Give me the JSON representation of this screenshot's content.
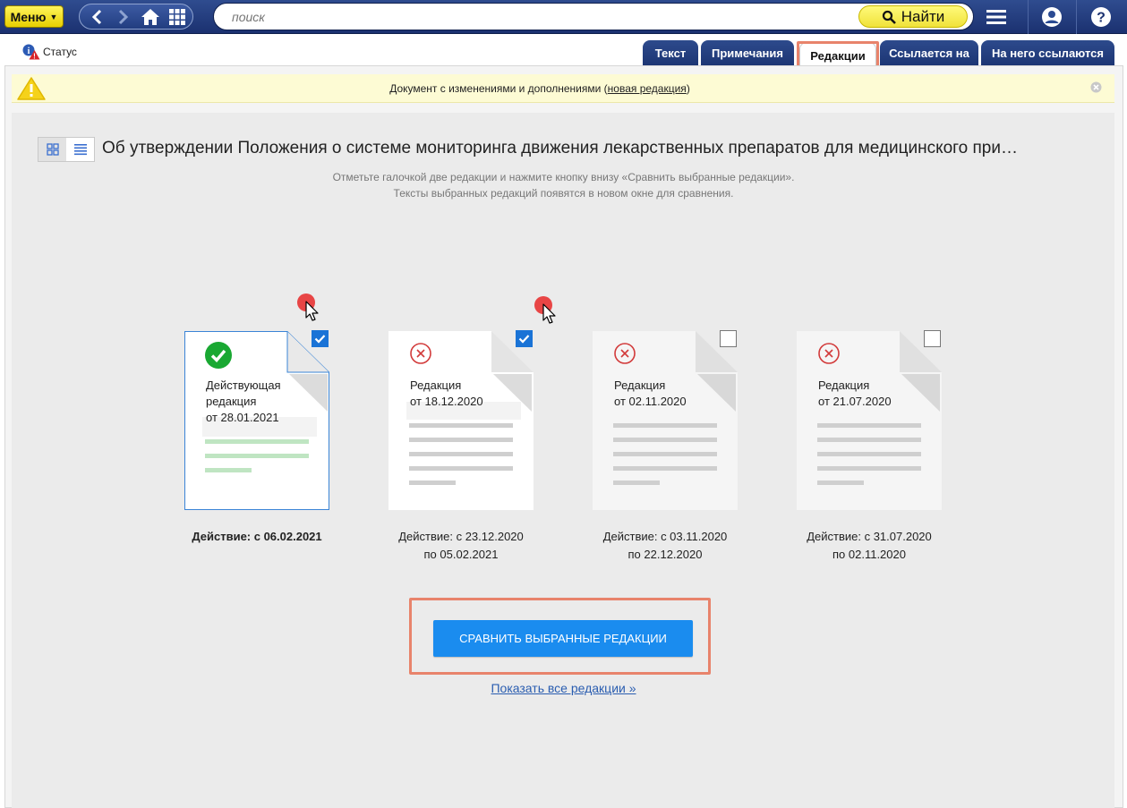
{
  "toolbar": {
    "menu_label": "Меню",
    "search_placeholder": "поиск",
    "find_label": "Найти"
  },
  "status": {
    "label": "Статус"
  },
  "tabs": [
    {
      "label": "Текст",
      "active": false
    },
    {
      "label": "Примечания",
      "active": false
    },
    {
      "label": "Редакции",
      "active": true
    },
    {
      "label": "Ссылается на",
      "active": false
    },
    {
      "label": "На него ссылаются",
      "active": false
    }
  ],
  "notice": {
    "text": "Документ с изменениями и дополнениями (",
    "link": "новая редакция",
    "text_end": ")"
  },
  "document": {
    "title": "Об утверждении Положения о системе мониторинга движения лекарственных препаратов для медицинского при…",
    "hint_line1": "Отметьте галочкой две редакции и нажмите кнопку внизу «Сравнить выбранные редакции».",
    "hint_line2": "Тексты выбранных редакций появятся в новом окне для сравнения."
  },
  "revisions": [
    {
      "line1": "Действующая",
      "line2": "редакция",
      "line3": "от 28.01.2021",
      "action1": "Действие: с 06.02.2021",
      "action2": "",
      "checked": true,
      "current": true
    },
    {
      "line1": "Редакция",
      "line2": "от 18.12.2020",
      "line3": "",
      "action1": "Действие: с 23.12.2020",
      "action2": "по 05.02.2021",
      "checked": true,
      "current": false
    },
    {
      "line1": "Редакция",
      "line2": "от 02.11.2020",
      "line3": "",
      "action1": "Действие: с 03.11.2020",
      "action2": "по 22.12.2020",
      "checked": false,
      "current": false
    },
    {
      "line1": "Редакция",
      "line2": "от 21.07.2020",
      "line3": "",
      "action1": "Действие: с 31.07.2020",
      "action2": "по 02.11.2020",
      "checked": false,
      "current": false
    }
  ],
  "actions": {
    "compare_label": "СРАВНИТЬ ВЫБРАННЫЕ РЕДАКЦИИ",
    "show_all_label": "Показать все редакции »"
  },
  "colors": {
    "accent": "#1a8cef",
    "highlight": "#e8836b",
    "toolbar": "#1b3170",
    "current_ok": "#19a832",
    "inactive_x": "#d23a3a"
  }
}
